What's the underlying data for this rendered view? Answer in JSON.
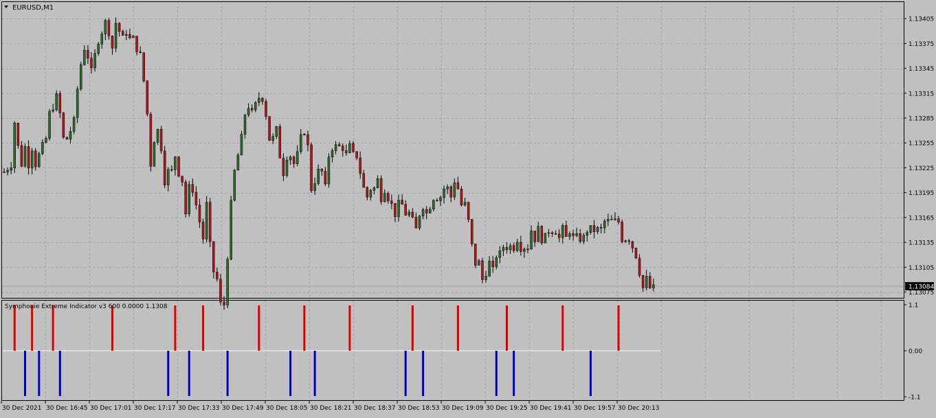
{
  "window": {
    "title": "EURUSD,M1",
    "collapse_icon": "triangle-down-icon"
  },
  "colors": {
    "background": "#c0c0c0",
    "grid": "#a8a8a8",
    "frame": "#000000",
    "bull_body": "#2e6b2e",
    "bear_body": "#b01818",
    "wick": "#000000",
    "price_tag_bg": "#000000",
    "price_tag_text": "#ffffff",
    "indicator_red": "#dd0000",
    "indicator_blue": "#0000bb",
    "zero_line": "#ffffff"
  },
  "chart_data": [
    {
      "type": "candlestick",
      "symbol": "EURUSD",
      "timeframe": "M1",
      "title": "EURUSD,M1",
      "ylim": [
        1.13068,
        1.13425
      ],
      "y_ticks": [
        "1.13405",
        "1.13375",
        "1.13345",
        "1.13315",
        "1.13285",
        "1.13255",
        "1.13225",
        "1.13195",
        "1.13165",
        "1.13135",
        "1.13105",
        "1.13075"
      ],
      "current_price": "1.13084",
      "x_tick_labels": [
        "30 Dec 2021",
        "30 Dec 16:45",
        "30 Dec 17:01",
        "30 Dec 17:17",
        "30 Dec 17:33",
        "30 Dec 17:49",
        "30 Dec 18:05",
        "30 Dec 18:21",
        "30 Dec 18:37",
        "30 Dec 18:53",
        "30 Dec 19:09",
        "30 Dec 19:25",
        "30 Dec 19:41",
        "30 Dec 19:57",
        "30 Dec 20:13"
      ],
      "grid": true,
      "close_path": [
        [
          0,
          1.1322
        ],
        [
          2,
          1.1323
        ],
        [
          3,
          1.1328
        ],
        [
          4,
          1.1325
        ],
        [
          5,
          1.1323
        ],
        [
          6,
          1.1325
        ],
        [
          7,
          1.1323
        ],
        [
          8,
          1.1325
        ],
        [
          9,
          1.1323
        ],
        [
          11,
          1.1325
        ],
        [
          12,
          1.1326
        ],
        [
          13,
          1.1329
        ],
        [
          15,
          1.1331
        ],
        [
          16,
          1.1329
        ],
        [
          17,
          1.1326
        ],
        [
          18,
          1.1326
        ],
        [
          19,
          1.1327
        ],
        [
          20,
          1.1328
        ],
        [
          21,
          1.1332
        ],
        [
          22,
          1.1335
        ],
        [
          23,
          1.1337
        ],
        [
          24,
          1.1336
        ],
        [
          25,
          1.1334
        ],
        [
          26,
          1.1336
        ],
        [
          27,
          1.1338
        ],
        [
          28,
          1.1339
        ],
        [
          29,
          1.134
        ],
        [
          30,
          1.1339
        ],
        [
          31,
          1.1337
        ],
        [
          32,
          1.134
        ],
        [
          33,
          1.1339
        ],
        [
          34,
          1.1338
        ],
        [
          35,
          1.1339
        ],
        [
          36,
          1.1338
        ],
        [
          37,
          1.1338
        ],
        [
          38,
          1.1337
        ],
        [
          39,
          1.1336
        ],
        [
          40,
          1.1333
        ],
        [
          41,
          1.1329
        ],
        [
          42,
          1.1323
        ],
        [
          43,
          1.1326
        ],
        [
          44,
          1.1327
        ],
        [
          45,
          1.1325
        ],
        [
          46,
          1.1321
        ],
        [
          47,
          1.1322
        ],
        [
          48,
          1.1322
        ],
        [
          49,
          1.1324
        ],
        [
          50,
          1.1322
        ],
        [
          51,
          1.1321
        ],
        [
          52,
          1.1317
        ],
        [
          53,
          1.132
        ],
        [
          54,
          1.132
        ],
        [
          55,
          1.1318
        ],
        [
          56,
          1.1316
        ],
        [
          57,
          1.1314
        ],
        [
          58,
          1.1318
        ],
        [
          59,
          1.1313
        ],
        [
          60,
          1.131
        ],
        [
          61,
          1.1309
        ],
        [
          62,
          1.1306
        ],
        [
          63,
          1.1306
        ],
        [
          64,
          1.1312
        ],
        [
          65,
          1.1318
        ],
        [
          66,
          1.1322
        ],
        [
          67,
          1.1324
        ],
        [
          68,
          1.1326
        ],
        [
          69,
          1.1329
        ],
        [
          70,
          1.133
        ],
        [
          71,
          1.1329
        ],
        [
          72,
          1.133
        ],
        [
          73,
          1.1331
        ],
        [
          74,
          1.1331
        ],
        [
          75,
          1.1329
        ],
        [
          76,
          1.1326
        ],
        [
          77,
          1.1326
        ],
        [
          78,
          1.1327
        ],
        [
          79,
          1.1324
        ],
        [
          80,
          1.1322
        ],
        [
          81,
          1.1324
        ],
        [
          82,
          1.1324
        ],
        [
          83,
          1.1323
        ],
        [
          84,
          1.1324
        ],
        [
          85,
          1.1326
        ],
        [
          86,
          1.1327
        ],
        [
          87,
          1.1325
        ],
        [
          88,
          1.132
        ],
        [
          89,
          1.1321
        ],
        [
          90,
          1.1322
        ],
        [
          91,
          1.1322
        ],
        [
          92,
          1.132
        ],
        [
          93,
          1.1324
        ],
        [
          94,
          1.1325
        ],
        [
          95,
          1.1325
        ],
        [
          96,
          1.1325
        ],
        [
          97,
          1.1325
        ],
        [
          98,
          1.1324
        ],
        [
          99,
          1.1325
        ],
        [
          100,
          1.1324
        ],
        [
          101,
          1.1324
        ],
        [
          102,
          1.1322
        ],
        [
          103,
          1.132
        ],
        [
          104,
          1.1319
        ],
        [
          105,
          1.132
        ],
        [
          106,
          1.132
        ],
        [
          107,
          1.1321
        ],
        [
          108,
          1.1319
        ],
        [
          109,
          1.132
        ],
        [
          110,
          1.1319
        ],
        [
          111,
          1.1318
        ],
        [
          112,
          1.1317
        ],
        [
          113,
          1.1318
        ],
        [
          114,
          1.1318
        ],
        [
          115,
          1.1317
        ],
        [
          116,
          1.1317
        ],
        [
          117,
          1.1316
        ],
        [
          118,
          1.1315
        ],
        [
          119,
          1.1317
        ],
        [
          120,
          1.1318
        ],
        [
          121,
          1.1317
        ],
        [
          122,
          1.1318
        ],
        [
          123,
          1.1319
        ],
        [
          124,
          1.1319
        ],
        [
          125,
          1.1319
        ],
        [
          126,
          1.132
        ],
        [
          127,
          1.132
        ],
        [
          128,
          1.1319
        ],
        [
          129,
          1.1321
        ],
        [
          130,
          1.132
        ],
        [
          131,
          1.1318
        ],
        [
          132,
          1.1318
        ],
        [
          133,
          1.1316
        ],
        [
          134,
          1.1313
        ],
        [
          135,
          1.1311
        ],
        [
          136,
          1.1311
        ],
        [
          137,
          1.1309
        ],
        [
          138,
          1.131
        ],
        [
          139,
          1.1311
        ],
        [
          140,
          1.131
        ],
        [
          141,
          1.1312
        ],
        [
          142,
          1.1312
        ],
        [
          143,
          1.1313
        ],
        [
          144,
          1.1313
        ],
        [
          145,
          1.1313
        ],
        [
          146,
          1.1313
        ],
        [
          147,
          1.1314
        ],
        [
          148,
          1.1313
        ],
        [
          149,
          1.1313
        ],
        [
          150,
          1.1313
        ],
        [
          151,
          1.1315
        ],
        [
          152,
          1.1314
        ],
        [
          153,
          1.1315
        ],
        [
          154,
          1.1314
        ],
        [
          155,
          1.1314
        ],
        [
          156,
          1.1315
        ],
        [
          157,
          1.1315
        ],
        [
          158,
          1.1315
        ],
        [
          159,
          1.1314
        ],
        [
          160,
          1.1315
        ],
        [
          161,
          1.1314
        ],
        [
          162,
          1.1315
        ],
        [
          163,
          1.1314
        ],
        [
          164,
          1.1314
        ],
        [
          165,
          1.1314
        ],
        [
          166,
          1.1314
        ],
        [
          167,
          1.1315
        ],
        [
          168,
          1.1315
        ],
        [
          169,
          1.1315
        ],
        [
          170,
          1.1315
        ],
        [
          171,
          1.1315
        ],
        [
          172,
          1.1316
        ],
        [
          173,
          1.1316
        ],
        [
          174,
          1.1316
        ],
        [
          175,
          1.1316
        ],
        [
          176,
          1.1316
        ],
        [
          177,
          1.1314
        ],
        [
          178,
          1.1314
        ],
        [
          179,
          1.1314
        ],
        [
          180,
          1.1313
        ],
        [
          181,
          1.1312
        ],
        [
          182,
          1.131
        ],
        [
          183,
          1.1308
        ],
        [
          184,
          1.1309
        ],
        [
          185,
          1.1308
        ],
        [
          186,
          1.13084
        ]
      ]
    },
    {
      "type": "bar",
      "title": "Symphonie Extreme Indicator v3 600 0.0000 1.1308",
      "ylim": [
        -1.1,
        1.1
      ],
      "y_ticks": [
        "1.1",
        "0.00",
        "-1.1"
      ],
      "bars": [
        {
          "i": 3,
          "value": 1.0
        },
        {
          "i": 6,
          "value": -1.0
        },
        {
          "i": 8,
          "value": 1.0
        },
        {
          "i": 10,
          "value": -1.0
        },
        {
          "i": 14,
          "value": 1.0
        },
        {
          "i": 16,
          "value": -1.0
        },
        {
          "i": 31,
          "value": 1.0
        },
        {
          "i": 47,
          "value": -1.0
        },
        {
          "i": 49,
          "value": 1.0
        },
        {
          "i": 53,
          "value": -1.0
        },
        {
          "i": 57,
          "value": 1.0
        },
        {
          "i": 64,
          "value": -1.0
        },
        {
          "i": 73,
          "value": 1.0
        },
        {
          "i": 82,
          "value": -1.0
        },
        {
          "i": 86,
          "value": 1.0
        },
        {
          "i": 89,
          "value": -1.0
        },
        {
          "i": 99,
          "value": 1.0
        },
        {
          "i": 115,
          "value": -1.0
        },
        {
          "i": 117,
          "value": 1.0
        },
        {
          "i": 120,
          "value": -1.0
        },
        {
          "i": 130,
          "value": 1.0
        },
        {
          "i": 141,
          "value": -1.0
        },
        {
          "i": 144,
          "value": 1.0
        },
        {
          "i": 146,
          "value": -1.0
        },
        {
          "i": 160,
          "value": 1.0
        },
        {
          "i": 168,
          "value": -1.0
        },
        {
          "i": 176,
          "value": 1.0
        }
      ],
      "zero_line_to": 188
    }
  ]
}
